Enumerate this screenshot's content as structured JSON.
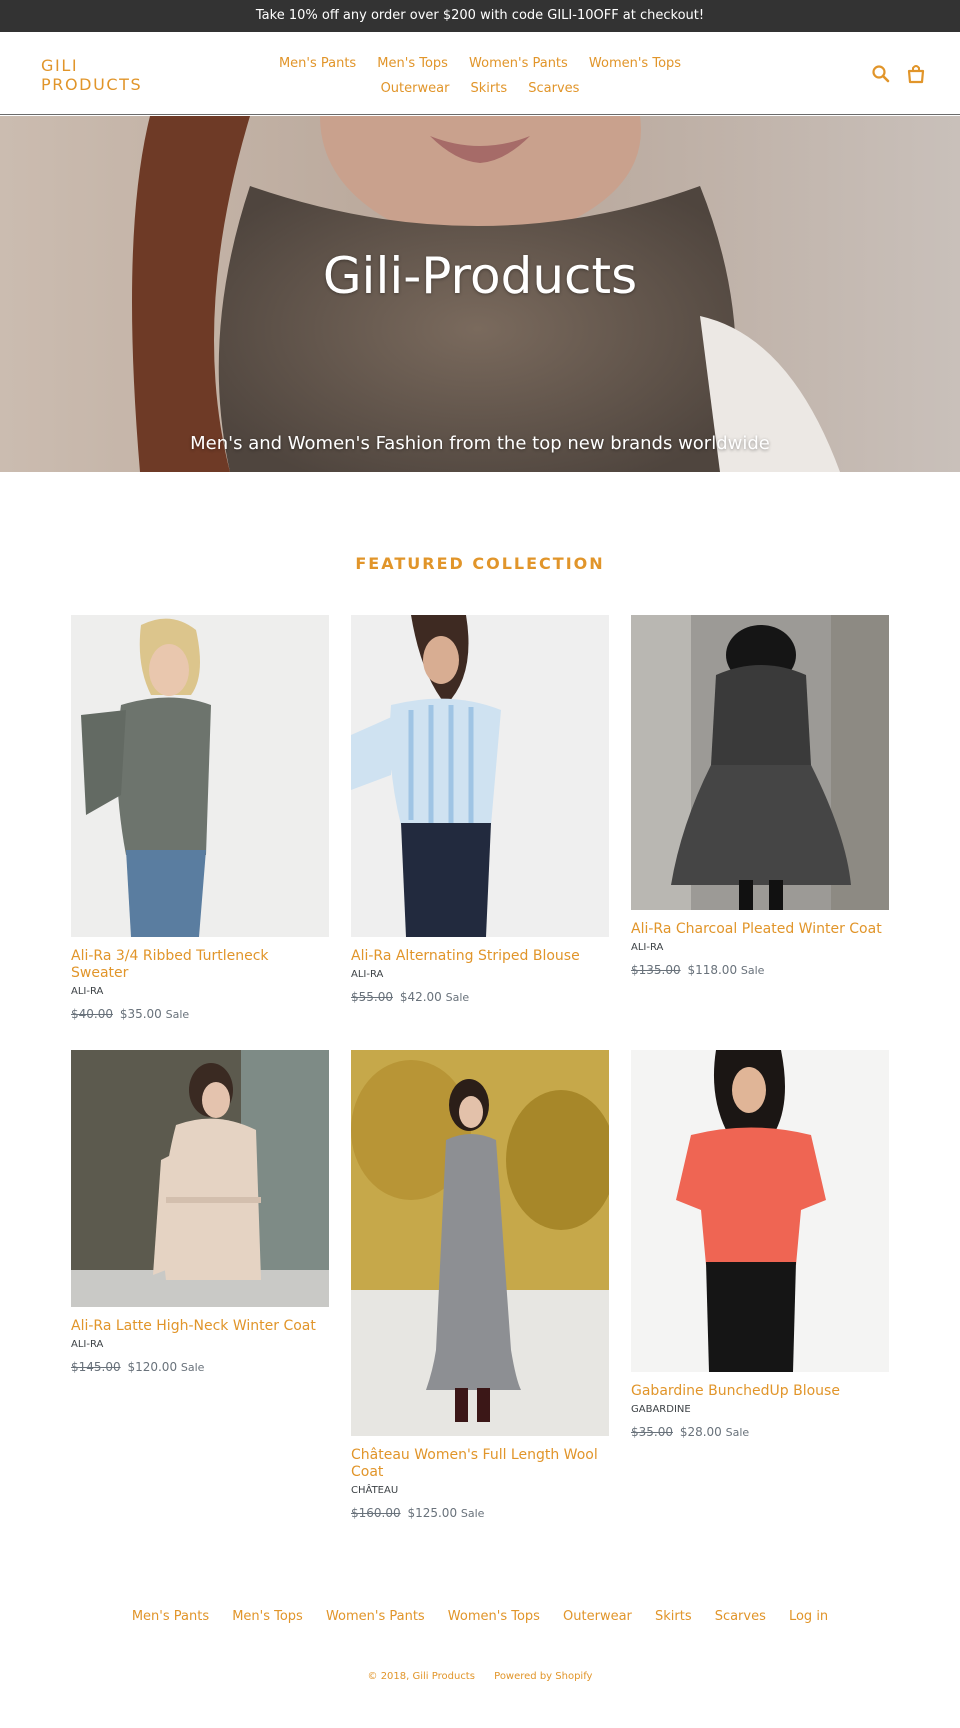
{
  "announcement": "Take 10% off any order over $200 with code GILI-10OFF at checkout!",
  "colors": {
    "accent": "#e1952a",
    "announcement_bg": "#333333",
    "text": "#3d4246",
    "muted": "#69727b"
  },
  "header": {
    "logo_line1": "GILI",
    "logo_line2": "PRODUCTS",
    "nav": [
      "Men's Pants",
      "Men's Tops",
      "Women's Pants",
      "Women's Tops",
      "Outerwear",
      "Skirts",
      "Scarves"
    ],
    "icons": [
      "search-icon",
      "cart-icon"
    ]
  },
  "hero": {
    "title": "Gili-Products",
    "subtitle": "Men's and Women's Fashion from the top new brands worldwide"
  },
  "featured": {
    "heading": "Featured collection",
    "products": [
      {
        "title": "Ali-Ra 3/4 Ribbed Turtleneck Sweater",
        "vendor": "ALI-RA",
        "compare_price": "$40.00",
        "price": "$35.00",
        "sale_label": "Sale"
      },
      {
        "title": "Ali-Ra Alternating Striped Blouse",
        "vendor": "ALI-RA",
        "compare_price": "$55.00",
        "price": "$42.00",
        "sale_label": "Sale"
      },
      {
        "title": "Ali-Ra Charcoal Pleated Winter Coat",
        "vendor": "ALI-RA",
        "compare_price": "$135.00",
        "price": "$118.00",
        "sale_label": "Sale"
      },
      {
        "title": "Ali-Ra Latte High-Neck Winter Coat",
        "vendor": "ALI-RA",
        "compare_price": "$145.00",
        "price": "$120.00",
        "sale_label": "Sale"
      },
      {
        "title": "Château Women's Full Length Wool Coat",
        "vendor": "CHÂTEAU",
        "compare_price": "$160.00",
        "price": "$125.00",
        "sale_label": "Sale"
      },
      {
        "title": "Gabardine BunchedUp Blouse",
        "vendor": "GABARDINE",
        "compare_price": "$35.00",
        "price": "$28.00",
        "sale_label": "Sale"
      }
    ]
  },
  "footer": {
    "nav": [
      "Men's Pants",
      "Men's Tops",
      "Women's Pants",
      "Women's Tops",
      "Outerwear",
      "Skirts",
      "Scarves",
      "Log in"
    ],
    "copyright": "© 2018, Gili Products",
    "powered": "Powered by Shopify"
  }
}
